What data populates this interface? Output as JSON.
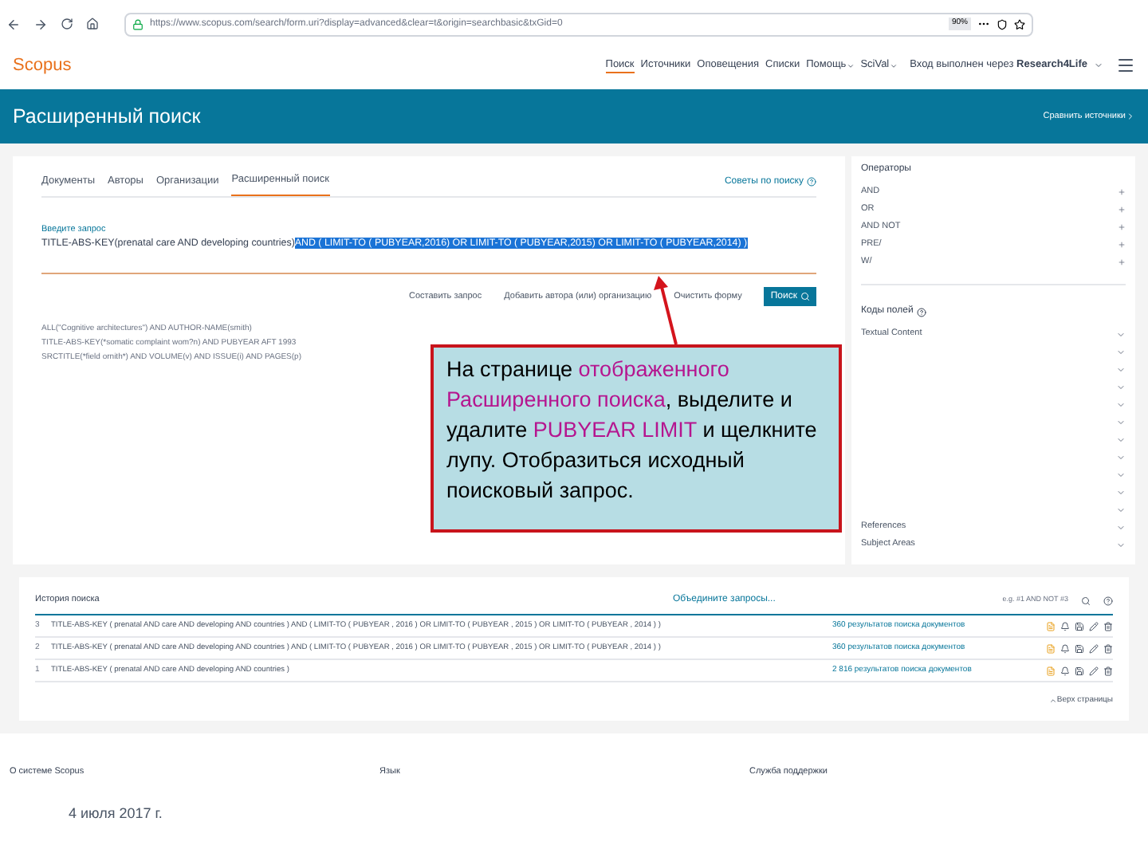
{
  "browser": {
    "url": "https://www.scopus.com/search/form.uri?display=advanced&clear=t&origin=searchbasic&txGid=0",
    "zoom": "90%"
  },
  "header": {
    "logo": "Scopus",
    "nav": [
      {
        "label": "Поиск",
        "selected": true,
        "dropdown": false
      },
      {
        "label": "Источники",
        "selected": false,
        "dropdown": false
      },
      {
        "label": "Оповещения",
        "selected": false,
        "dropdown": false
      },
      {
        "label": "Списки",
        "selected": false,
        "dropdown": false
      },
      {
        "label": "Помощь",
        "selected": false,
        "dropdown": true
      },
      {
        "label": "SciVal",
        "selected": false,
        "dropdown": true
      }
    ],
    "login": "Вход выполнен через **Research4Life**"
  },
  "banner": {
    "title": "Расширенный поиск",
    "link": "Сравнить источники"
  },
  "tabs": [
    {
      "label": "Документы",
      "selected": false
    },
    {
      "label": "Авторы",
      "selected": false
    },
    {
      "label": "Организации",
      "selected": false
    },
    {
      "label": "Расширенный поиск",
      "selected": true
    }
  ],
  "tips": "Советы по поиску",
  "query": {
    "label": "Введите запрос",
    "text": "TITLE-ABS-KEY(prenatal care AND developing countries)",
    "selected_text": "AND ( LIMIT-TO ( PUBYEAR,2016) OR LIMIT-TO ( PUBYEAR,2015) OR LIMIT-TO ( PUBYEAR,2014) )"
  },
  "actions": [
    "Составить запрос",
    "Добавить автора (или) организацию",
    "Очистить форму"
  ],
  "search_button": "Поиск",
  "examples": [
    "ALL(\"Cognitive architectures\") AND AUTHOR-NAME(smith)",
    "TITLE-ABS-KEY(*somatic complaint wom?n) AND PUBYEAR AFT 1993",
    "SRCTITLE(*field ornith*) AND VOLUME(v) AND ISSUE(i) AND PAGES(p)"
  ],
  "operators": {
    "title": "Операторы",
    "items": [
      "AND",
      "OR",
      "AND NOT",
      "PRE/",
      "W/"
    ]
  },
  "field_codes": {
    "title": "Коды полей",
    "top": "Textual Content",
    "bottom": [
      "References",
      "Subject Areas"
    ]
  },
  "callout": [
    {
      "text": "На странице ",
      "highlight": false
    },
    {
      "text": "отображенного Расширенного поиска",
      "highlight": true
    },
    {
      "text": ", выделите и удалите ",
      "highlight": false
    },
    {
      "text": "PUBYEAR LIMIT",
      "highlight": true
    },
    {
      "text": " и щелкните лупу.  Отобразиться исходный поисковый запрос.",
      "highlight": false
    }
  ],
  "history": {
    "title": "История поиска",
    "combine": "Объедините запросы...",
    "hint": "e.g. #1 AND NOT #3",
    "rows": [
      {
        "number": "3",
        "query": "TITLE-ABS-KEY ( prenatal AND care AND developing AND countries ) AND ( LIMIT-TO ( PUBYEAR , 2016 ) OR LIMIT-TO ( PUBYEAR , 2015 ) OR LIMIT-TO ( PUBYEAR , 2014 ) )",
        "results": "360 результатов поиска документов"
      },
      {
        "number": "2",
        "query": "TITLE-ABS-KEY ( prenatal AND care AND developing AND countries ) AND ( LIMIT-TO ( PUBYEAR , 2016 ) OR LIMIT-TO ( PUBYEAR , 2015 ) OR LIMIT-TO ( PUBYEAR , 2014 ) )",
        "results": "360 результатов поиска документов"
      },
      {
        "number": "1",
        "query": "TITLE-ABS-KEY ( prenatal AND care AND developing AND countries )",
        "results": "2 816 результатов поиска документов"
      }
    ],
    "top_link": "Верх страницы"
  },
  "footer": [
    "О системе Scopus",
    "Язык",
    "Служба поддержки"
  ],
  "date": "4 июля 2017 г."
}
